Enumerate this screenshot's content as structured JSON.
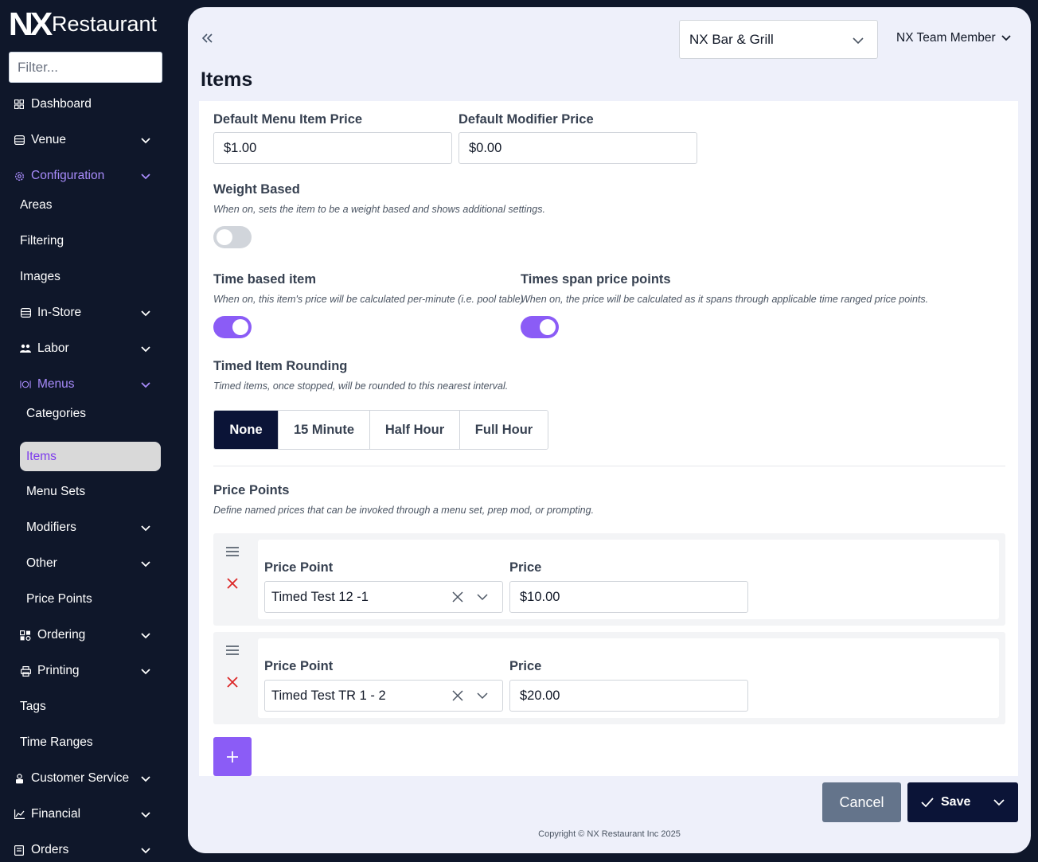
{
  "brand": {
    "logo_mark": "NX",
    "logo_text": "Restaurant"
  },
  "sidebar": {
    "filter_placeholder": "Filter...",
    "items": [
      {
        "label": "Dashboard",
        "icon": "dashboard-icon"
      },
      {
        "label": "Venue",
        "icon": "venue-icon"
      },
      {
        "label": "Configuration",
        "icon": "gear-icon"
      },
      {
        "label": "Areas"
      },
      {
        "label": "Filtering"
      },
      {
        "label": "Images"
      },
      {
        "label": "In-Store",
        "icon": "store-icon"
      },
      {
        "label": "Labor",
        "icon": "people-icon"
      },
      {
        "label": "Menus",
        "icon": "utensils-icon"
      },
      {
        "label": "Categories"
      },
      {
        "label": "Items"
      },
      {
        "label": "Menu Sets"
      },
      {
        "label": "Modifiers"
      },
      {
        "label": "Other"
      },
      {
        "label": "Price Points"
      },
      {
        "label": "Ordering",
        "icon": "ordering-icon"
      },
      {
        "label": "Printing",
        "icon": "printer-icon"
      },
      {
        "label": "Tags"
      },
      {
        "label": "Time Ranges"
      },
      {
        "label": "Customer Service",
        "icon": "customer-service-icon"
      },
      {
        "label": "Financial",
        "icon": "chart-icon"
      },
      {
        "label": "Orders",
        "icon": "orders-icon"
      }
    ]
  },
  "header": {
    "venue": "NX Bar & Grill",
    "user": "NX Team Member",
    "page_title": "Items"
  },
  "form": {
    "default_menu_item_price": {
      "label": "Default Menu Item Price",
      "value": "$1.00"
    },
    "default_modifier_price": {
      "label": "Default Modifier Price",
      "value": "$0.00"
    },
    "weight_based": {
      "label": "Weight Based",
      "desc": "When on, sets the item to be a weight based and shows additional settings.",
      "on": false
    },
    "time_based": {
      "label": "Time based item",
      "desc": "When on, this item's price will be calculated per-minute (i.e. pool table)",
      "on": true
    },
    "times_span": {
      "label": "Times span price points",
      "desc": "When on, the price will be calculated as it spans through applicable time ranged price points.",
      "on": true
    },
    "rounding": {
      "label": "Timed Item Rounding",
      "desc": "Timed items, once stopped, will be rounded to this nearest interval.",
      "options": [
        "None",
        "15 Minute",
        "Half Hour",
        "Full Hour"
      ],
      "selected": "None"
    },
    "price_points": {
      "label": "Price Points",
      "desc": "Define named prices that can be invoked through a menu set, prep mod, or prompting.",
      "col_point": "Price Point",
      "col_price": "Price",
      "rows": [
        {
          "point": "Timed Test 12 -1",
          "price": "$10.00"
        },
        {
          "point": "Timed Test TR 1 - 2",
          "price": "$20.00"
        }
      ]
    }
  },
  "actions": {
    "cancel": "Cancel",
    "save": "Save"
  },
  "footer": {
    "copyright": "Copyright © NX Restaurant Inc 2025"
  },
  "colors": {
    "accent": "#8b5cf6",
    "navy": "#0b1437",
    "sidebar_bg": "#0f172a",
    "delete": "#dc2626"
  }
}
